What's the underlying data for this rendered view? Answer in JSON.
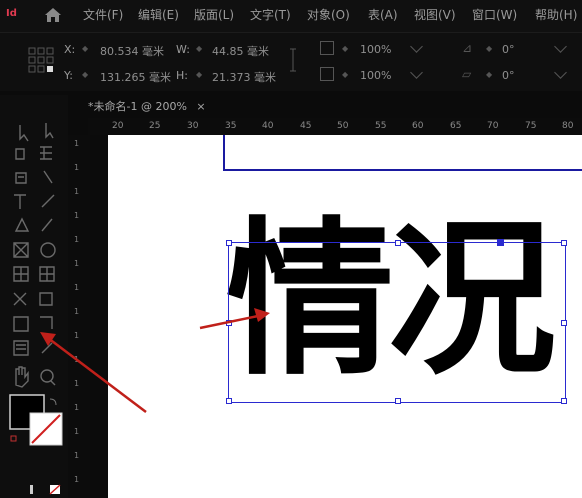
{
  "menu": {
    "logo": "Id",
    "items": [
      "文件(F)",
      "编辑(E)",
      "版面(L)",
      "文字(T)",
      "对象(O)",
      "表(A)",
      "视图(V)",
      "窗口(W)",
      "帮助(H)"
    ]
  },
  "control": {
    "x_label": "X:",
    "x_value": "80.534 毫米",
    "y_label": "Y:",
    "y_value": "131.265 毫米",
    "w_label": "W:",
    "w_value": "44.85 毫米",
    "h_label": "H:",
    "h_value": "21.373 毫米",
    "scale_x": "100%",
    "scale_y": "100%",
    "rotate": "0°",
    "shear": "0°"
  },
  "tab": {
    "title": "*未命名-1 @ 200%",
    "close": "×"
  },
  "ruler": {
    "h_ticks": [
      "20",
      "25",
      "30",
      "35",
      "40",
      "45",
      "50",
      "55",
      "60",
      "65",
      "70",
      "75",
      "80"
    ],
    "v_ticks": [
      "1",
      "1",
      "1",
      "1",
      "1",
      "1",
      "1",
      "1",
      "1",
      "1",
      "1",
      "1",
      "1",
      "1",
      "1"
    ]
  },
  "canvas": {
    "text": "情况"
  },
  "colors": {
    "selection": "#2a2ad0",
    "arrow": "#c0201a",
    "page_border": "#1a1aa0",
    "logo": "#e03a50"
  }
}
